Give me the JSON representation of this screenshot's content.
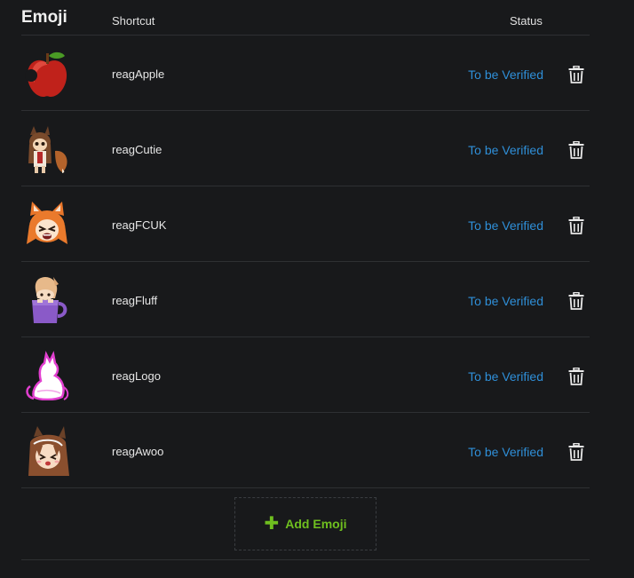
{
  "header": {
    "title": "Emoji",
    "shortcut_label": "Shortcut",
    "status_label": "Status"
  },
  "emojis": [
    {
      "shortcut": "reagApple",
      "status": "To be Verified",
      "icon": "apple-icon"
    },
    {
      "shortcut": "reagCutie",
      "status": "To be Verified",
      "icon": "fox-girl-icon"
    },
    {
      "shortcut": "reagFCUK",
      "status": "To be Verified",
      "icon": "orange-fox-icon"
    },
    {
      "shortcut": "reagFluff",
      "status": "To be Verified",
      "icon": "mug-girl-icon"
    },
    {
      "shortcut": "reagLogo",
      "status": "To be Verified",
      "icon": "logo-silhouette-icon"
    },
    {
      "shortcut": "reagAwoo",
      "status": "To be Verified",
      "icon": "awoo-girl-icon"
    }
  ],
  "add_button": {
    "label": "Add Emoji"
  },
  "colors": {
    "background": "#18191b",
    "status": "#2f8fd8",
    "accent": "#6fbf1f"
  }
}
